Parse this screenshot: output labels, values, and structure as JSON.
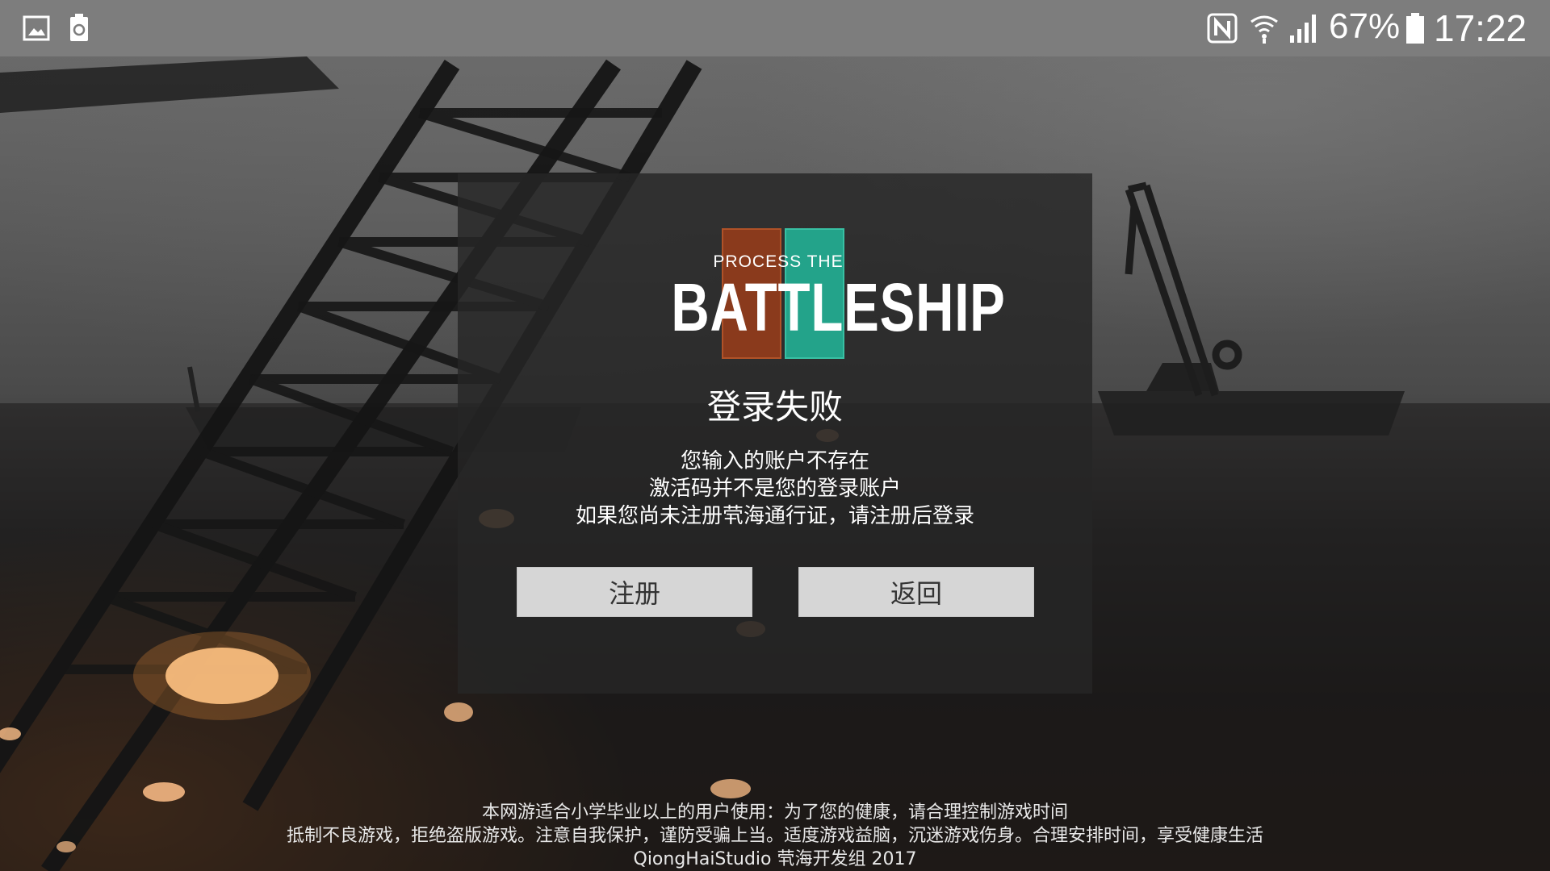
{
  "status_bar": {
    "battery_percent": "67%",
    "time": "17:22",
    "left_icons": [
      "gallery-icon",
      "recycle-icon"
    ],
    "right_icons": [
      "nfc-icon",
      "wifi-icon",
      "signal-icon",
      "battery-icon"
    ]
  },
  "logo": {
    "line1": "PROCESS THE",
    "line2": "BATTLESHIP",
    "colors": {
      "left_block": "#8a3a1c",
      "right_block": "#23a38a"
    }
  },
  "dialog": {
    "title": "登录失败",
    "message_lines": [
      "您输入的账户不存在",
      "激活码并不是您的登录账户",
      "如果您尚未注册茕海通行证，请注册后登录"
    ],
    "buttons": {
      "register": "注册",
      "back": "返回"
    }
  },
  "footer": {
    "lines": [
      "本网游适合小学毕业以上的用户使用：为了您的健康，请合理控制游戏时间",
      "抵制不良游戏，拒绝盗版游戏。注意自我保护，谨防受骗上当。适度游戏益脑，沉迷游戏伤身。合理安排时间，享受健康生活",
      "QiongHaiStudio 茕海开发组 2017"
    ]
  }
}
